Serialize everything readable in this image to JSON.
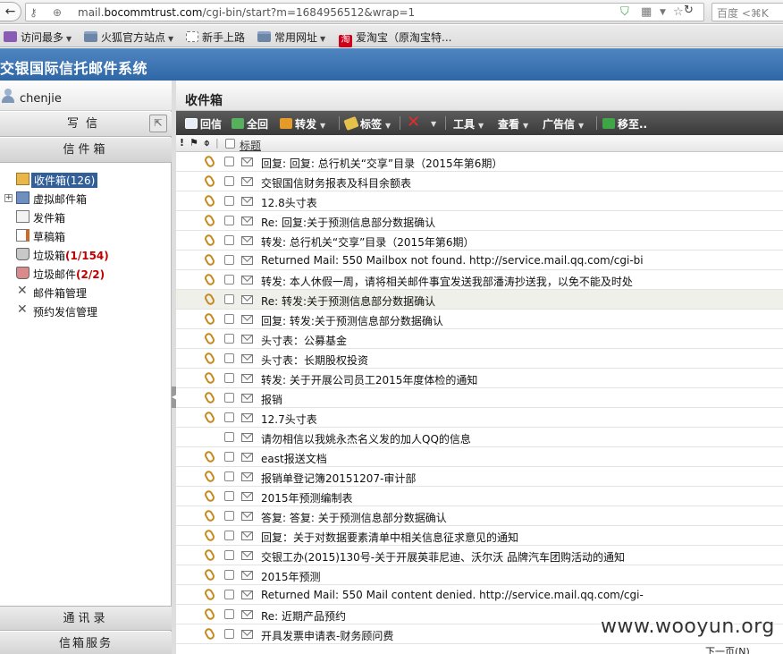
{
  "browser": {
    "url_prefix": "mail.",
    "url_domain": "bocommtrust.com",
    "url_path": "/cgi-bin/start?m=1684956512&wrap=1",
    "search_placeholder": "百度 <⌘K",
    "bookmarks": [
      {
        "label": "访问最多",
        "icon": "visited-icon",
        "has_menu": true
      },
      {
        "label": "火狐官方站点",
        "icon": "folder-icon",
        "has_menu": true
      },
      {
        "label": "新手上路",
        "icon": "page-icon",
        "has_menu": false
      },
      {
        "label": "常用网址",
        "icon": "folder-icon",
        "has_menu": true
      },
      {
        "label": "爱淘宝（原淘宝特...",
        "icon": "taobao-icon",
        "has_menu": false
      }
    ],
    "taobao_glyph": "淘"
  },
  "app": {
    "title": "交银国际信托邮件系统"
  },
  "sidebar": {
    "username": "chenjie",
    "compose_label": "写信",
    "mailbox_label": "信件箱",
    "folders": [
      {
        "label": "收件箱",
        "count": "(126)",
        "count_style": "normal",
        "icon": "inbox-icon",
        "selected": true,
        "expandable": false
      },
      {
        "label": "虚拟邮件箱",
        "count": "",
        "count_style": "normal",
        "icon": "virtual-mailbox-icon",
        "selected": false,
        "expandable": true
      },
      {
        "label": "发件箱",
        "count": "",
        "count_style": "normal",
        "icon": "sent-icon",
        "selected": false,
        "expandable": false
      },
      {
        "label": "草稿箱",
        "count": "",
        "count_style": "normal",
        "icon": "draft-icon",
        "selected": false,
        "expandable": false
      },
      {
        "label": "垃圾箱",
        "count": "(1/154)",
        "count_style": "red",
        "icon": "trash-icon",
        "selected": false,
        "expandable": false
      },
      {
        "label": "垃圾邮件",
        "count": "(2/2)",
        "count_style": "red",
        "icon": "spam-icon",
        "selected": false,
        "expandable": false
      },
      {
        "label": "邮件箱管理",
        "count": "",
        "count_style": "normal",
        "icon": "tools-icon",
        "selected": false,
        "expandable": false
      },
      {
        "label": "预约发信管理",
        "count": "",
        "count_style": "normal",
        "icon": "tools-icon",
        "selected": false,
        "expandable": false
      }
    ],
    "contacts_label": "通讯录",
    "services_label": "信箱服务"
  },
  "main": {
    "title": "收件箱",
    "toolbar": {
      "reply": "回信",
      "reply_all": "全回",
      "forward": "转发",
      "tag": "标签",
      "tools": "工具",
      "view": "查看",
      "ad_mail": "广告信",
      "move": "移至.."
    },
    "list_header": {
      "subject": "标题"
    },
    "messages": [
      {
        "subject": "回复: 回复: 总行机关“交享”目录（2015年第6期）",
        "attachment": true,
        "highlight": false
      },
      {
        "subject": "交银国信财务报表及科目余额表",
        "attachment": true,
        "highlight": false
      },
      {
        "subject": "12.8头寸表",
        "attachment": true,
        "highlight": false
      },
      {
        "subject": "Re: 回复:关于预测信息部分数据确认",
        "attachment": true,
        "highlight": false
      },
      {
        "subject": "转发: 总行机关“交享”目录（2015年第6期）",
        "attachment": true,
        "highlight": false
      },
      {
        "subject": "Returned Mail: 550 Mailbox not found. http://service.mail.qq.com/cgi-bi",
        "attachment": true,
        "highlight": false
      },
      {
        "subject": "转发: 本人休假一周，请将相关邮件事宜发送我部潘涛抄送我，以免不能及时处",
        "attachment": true,
        "highlight": false
      },
      {
        "subject": "Re: 转发:关于预测信息部分数据确认",
        "attachment": true,
        "highlight": true
      },
      {
        "subject": "回复: 转发:关于预测信息部分数据确认",
        "attachment": true,
        "highlight": false
      },
      {
        "subject": "头寸表：公募基金",
        "attachment": true,
        "highlight": false
      },
      {
        "subject": "头寸表：长期股权投资",
        "attachment": true,
        "highlight": false
      },
      {
        "subject": "转发: 关于开展公司员工2015年度体检的通知",
        "attachment": true,
        "highlight": false
      },
      {
        "subject": "报销",
        "attachment": true,
        "highlight": false
      },
      {
        "subject": "12.7头寸表",
        "attachment": true,
        "highlight": false
      },
      {
        "subject": "请勿相信以我姚永杰名义发的加人QQ的信息",
        "attachment": false,
        "highlight": false
      },
      {
        "subject": "east报送文档",
        "attachment": true,
        "highlight": false
      },
      {
        "subject": "报销单登记簿20151207-审计部",
        "attachment": true,
        "highlight": false
      },
      {
        "subject": "2015年预测编制表",
        "attachment": true,
        "highlight": false
      },
      {
        "subject": "答复: 答复: 关于预测信息部分数据确认",
        "attachment": true,
        "highlight": false
      },
      {
        "subject": "回复：关于对数据要素清单中相关信息征求意见的通知",
        "attachment": true,
        "highlight": false
      },
      {
        "subject": "交银工办(2015)130号-关于开展英菲尼迪、沃尔沃 品牌汽车团购活动的通知",
        "attachment": true,
        "highlight": false
      },
      {
        "subject": "2015年预测",
        "attachment": true,
        "highlight": false
      },
      {
        "subject": "Returned Mail: 550 Mail content denied. http://service.mail.qq.com/cgi-",
        "attachment": true,
        "highlight": false
      },
      {
        "subject": "Re: 近期产品预约",
        "attachment": true,
        "highlight": false
      },
      {
        "subject": "开具发票申请表-财务顾问费",
        "attachment": true,
        "highlight": false
      }
    ],
    "next_page": "下一页(N)"
  },
  "watermark": "www.wooyun.org"
}
